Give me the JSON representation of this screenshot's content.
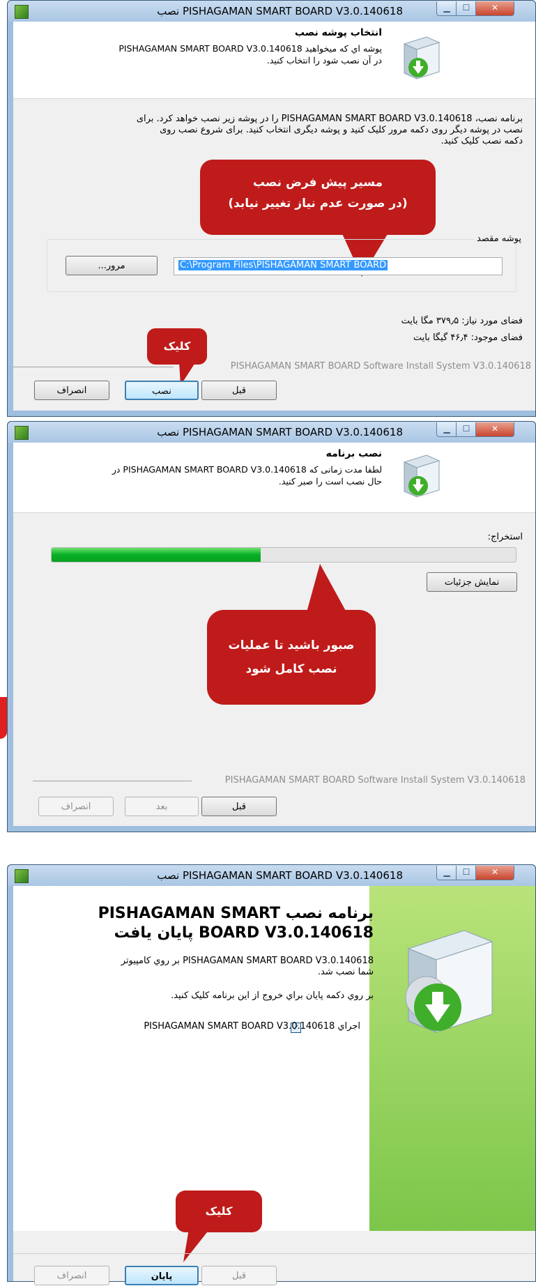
{
  "title": "PISHAGAMAN SMART BOARD V3.0.140618 نصب",
  "window1": {
    "header_title": "انتخاب پوشه نصب",
    "header_sub_line1": "پوشه اي که ميخواهيد  PISHAGAMAN SMART BOARD V3.0.140618",
    "header_sub_line2": "در آن نصب شود را انتخاب کنيد.",
    "body_line1": "برنامه نصب، PISHAGAMAN SMART BOARD V3.0.140618 را در پوشه زیر نصب خواهد کرد. برای",
    "body_line2": "نصب در پوشه دیگر روی دکمه مرور کلیک کنید و پوشه دیگری انتخاب کنید. برای شروع نصب روی",
    "body_line3": "دکمه نصب کلیک کنید.",
    "callout_line1": "مسیر پیش فرض نصب",
    "callout_line2": "(در صورت عدم نیاز تغییر نیابد)",
    "group_label": "پوشه مقصد",
    "path_value": "C:\\Program Files\\PISHAGAMAN SMART BOARD",
    "browse_button": "مرور...",
    "space_required": "فضای مورد نیاز: ۳۷۹٫۵ مگا بایت",
    "space_available": "فضای موجود: ۴۶٫۴ گیگا بایت",
    "callout_click": "کلیک",
    "brand": "PISHAGAMAN SMART BOARD Software Install System V3.0.140618",
    "back_button": "قبل",
    "install_button": "نصب",
    "cancel_button": "انصراف"
  },
  "window2": {
    "header_title": "نصب برنامه",
    "header_sub_line1": "لطفا مدت زمانی که  PISHAGAMAN SMART BOARD V3.0.140618 در",
    "header_sub_line2": "حال نصب است را صبر کنید.",
    "status_label": "استخراج:",
    "progress": 0.45,
    "details_button": "نمایش جزئیات",
    "callout_line1": "صبور باشید تا عملیات",
    "callout_line2": "نصب کامل شود",
    "brand": "PISHAGAMAN SMART BOARD Software Install System V3.0.140618",
    "back_button": "قبل",
    "next_button": "بعد",
    "cancel_button": "انصراف"
  },
  "window3": {
    "finish_title_line1": "برنامه نصب  PISHAGAMAN SMART",
    "finish_title_line2": "BOARD V3.0.140618 پایان یافت",
    "finish_text_line1": "PISHAGAMAN SMART BOARD V3.0.140618 بر روي کامپیوتر",
    "finish_text_line2": "شما نصب شد.",
    "finish_instruction": "بر روي دکمه پايان براي خروج از اين برنامه کلیک کنید.",
    "run_label": "اجراي  PISHAGAMAN SMART BOARD V3.0.140618",
    "run_checked": true,
    "callout_click": "کلیک",
    "back_button": "قبل",
    "finish_button": "پایان",
    "cancel_button": "انصراف"
  },
  "colors": {
    "callout": "#bf1b1b",
    "progress_fill": "#06b025",
    "finish_panel": "#8fd05a"
  }
}
